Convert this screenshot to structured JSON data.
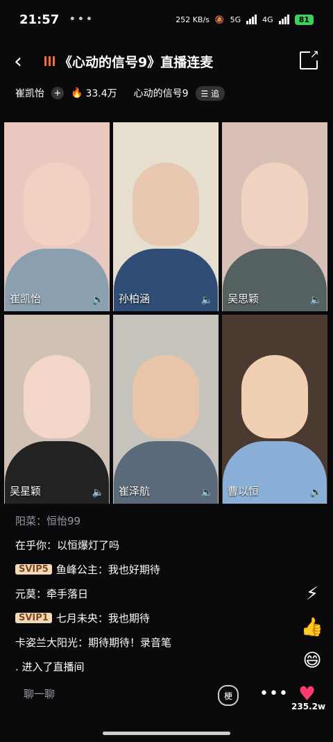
{
  "status": {
    "time": "21:57",
    "dots": "•••",
    "net": "252 KB/s",
    "mute": "🔕",
    "sig1": "5G",
    "sig2": "4G",
    "battery": "81"
  },
  "header": {
    "title": "《心动的信号9》直播连麦"
  },
  "meta": {
    "host": "崔凯怡",
    "heat": "33.4万",
    "show": "心动的信号9",
    "follow": "追"
  },
  "tiles": [
    {
      "name": "崔凯怡",
      "bg": "#e9c8c0",
      "face": "#f1d2c2",
      "cloth": "#8aa0b0"
    },
    {
      "name": "孙柏涵",
      "bg": "#e6dfd0",
      "face": "#e8c8b0",
      "cloth": "#2f4d75"
    },
    {
      "name": "吴思颖",
      "bg": "#d8c0b6",
      "face": "#f0d3c0",
      "cloth": "#556060"
    },
    {
      "name": "吴星颖",
      "bg": "#cfc2b4",
      "face": "#f4d6c8",
      "cloth": "#222"
    },
    {
      "name": "崔泽航",
      "bg": "#c6c3bd",
      "face": "#e8c4a8",
      "cloth": "#5a6a7a"
    },
    {
      "name": "曹以恒",
      "bg": "#4a3a30",
      "face": "#f1cfb2",
      "cloth": "#8ab0d8"
    }
  ],
  "speaker": "🔈",
  "chat": [
    {
      "badge": "",
      "user": "阳菜：",
      "msg": "恒怡99",
      "muted": true
    },
    {
      "badge": "",
      "user": "在乎你：",
      "msg": "以恒爆灯了吗",
      "muted": false
    },
    {
      "badge": "SVIP5",
      "user": "鱼峰公主：",
      "msg": "我也好期待",
      "muted": false
    },
    {
      "badge": "",
      "user": "元莫：",
      "msg": "牵手落日",
      "muted": false
    },
    {
      "badge": "SVIP1",
      "user": "七月未央：",
      "msg": "我也期待",
      "muted": false
    },
    {
      "badge": "",
      "user": "卡姿兰大阳光：",
      "msg": "期待期待！录音笔",
      "muted": false
    },
    {
      "badge": "",
      "user": "",
      "msg": ". 进入了直播间",
      "muted": false
    }
  ],
  "bottom": {
    "placeholder": "聊一聊",
    "emoji": "梗",
    "more": "•••",
    "heart": "♥",
    "likes": "235.2w"
  }
}
